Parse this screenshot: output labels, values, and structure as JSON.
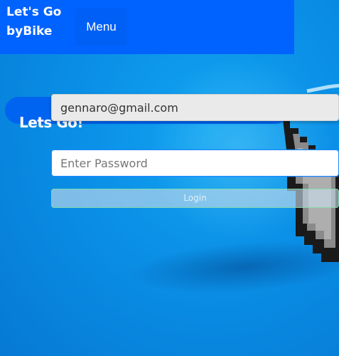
{
  "navbar": {
    "brand": "Let's Go byBike",
    "menu_label": "Menu"
  },
  "login": {
    "heading": "Lets Go!",
    "email_value": "gennaro@gmail.com",
    "password_placeholder": "Enter Password",
    "login_label": "Login"
  },
  "colors": {
    "navbar": "#0062ff",
    "background": "#0a8fe6",
    "banner": "#0064f0"
  },
  "icons": [
    "cursor-pointer-icon"
  ]
}
